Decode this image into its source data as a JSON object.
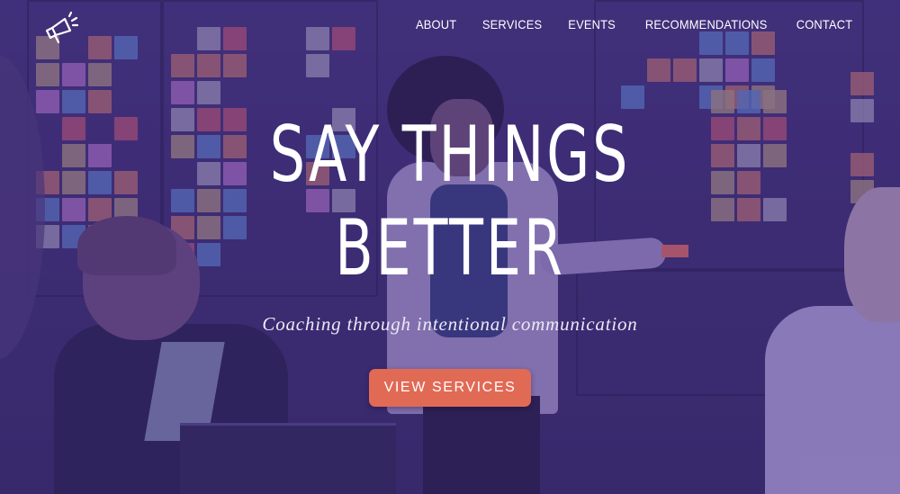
{
  "nav": {
    "about": "ABOUT",
    "services": "SERVICES",
    "events": "EVENTS",
    "recommendations": "RECOMMENDATIONS",
    "contact": "CONTACT"
  },
  "hero": {
    "headline_line1": "SAY THINGS",
    "headline_line2": "BETTER",
    "tagline": "Coaching through intentional communication",
    "cta_label": "VIEW SERVICES"
  },
  "logo": {
    "icon": "megaphone-icon"
  },
  "colors": {
    "overlay": "#48308c",
    "cta": "#e16a55",
    "text": "#ffffff"
  }
}
